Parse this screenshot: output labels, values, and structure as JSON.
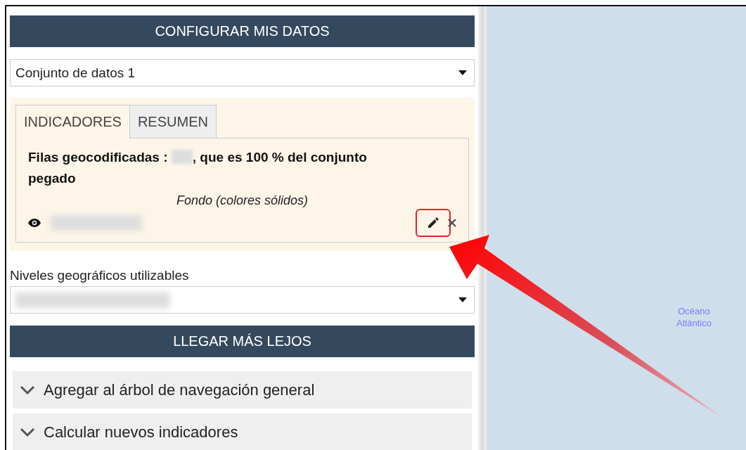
{
  "panel": {
    "header": "CONFIGURAR MIS DATOS",
    "dataset_select": {
      "value": "Conjunto de datos 1"
    },
    "tabs": [
      {
        "label": "INDICADORES",
        "selected": true
      },
      {
        "label": "RESUMEN",
        "selected": false
      }
    ],
    "summary": {
      "prefix": "Filas geocodificadas :",
      "suffix": ", que es 100 % del conjunto",
      "continuation": "pegado"
    },
    "layer_style": "Fondo (colores sólidos)",
    "layer": {
      "visible": true,
      "highlighted_edit": true
    },
    "levels_label": "Niveles geográficos utilizables",
    "section_header": "LLEGAR MÁS LEJOS",
    "accordion": [
      {
        "label": "Agregar al árbol de navegación general"
      },
      {
        "label": "Calcular nuevos indicadores"
      }
    ]
  },
  "map": {
    "label": "Océano\nAtlántico"
  }
}
